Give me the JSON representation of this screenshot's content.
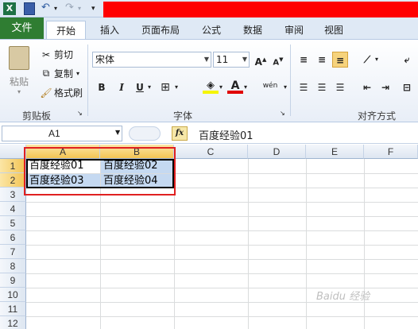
{
  "tabs": [
    "文件",
    "开始",
    "插入",
    "页面布局",
    "公式",
    "数据",
    "审阅",
    "视图"
  ],
  "clipboard": {
    "paste": "粘贴",
    "cut": "剪切",
    "copy": "复制",
    "format_painter": "格式刷",
    "group": "剪贴板"
  },
  "font": {
    "name": "宋体",
    "size": "11",
    "bold": "B",
    "italic": "I",
    "underline": "U",
    "color_letter": "A",
    "group": "字体",
    "phonetic": "wén"
  },
  "alignment": {
    "group": "对齐方式"
  },
  "namebox": "A1",
  "formula": "百度经验01",
  "fx": "fx",
  "columns": [
    "A",
    "B",
    "C",
    "D",
    "E",
    "F"
  ],
  "rows": [
    "1",
    "2",
    "3",
    "4",
    "5",
    "6",
    "7",
    "8",
    "9",
    "10",
    "11",
    "12"
  ],
  "cells": {
    "A1": "百度经验01",
    "B1": "百度经验02",
    "A2": "百度经验03",
    "B2": "百度经验04"
  },
  "watermark": "Baidu 经验",
  "colors": {
    "file_tab": "#2f7d32",
    "selection": "#c5d9f1",
    "highlight_box": "#e02020",
    "header_selected": "#f3c453"
  }
}
